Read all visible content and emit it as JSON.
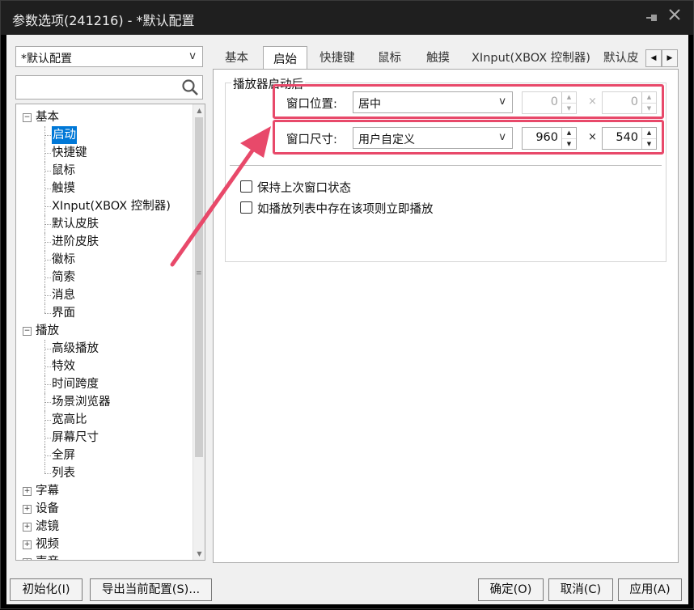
{
  "window": {
    "title": "参数选项(241216) - *默认配置",
    "pin_icon": "pin-icon",
    "close_icon": "close-icon"
  },
  "sidebar": {
    "profile": "*默认配置",
    "search_placeholder": "",
    "tree": [
      {
        "label": "基本",
        "type": "parent",
        "expander": "⊟"
      },
      {
        "label": "启动",
        "type": "child",
        "selected": true
      },
      {
        "label": "快捷键",
        "type": "child"
      },
      {
        "label": "鼠标",
        "type": "child"
      },
      {
        "label": "触摸",
        "type": "child"
      },
      {
        "label": "XInput(XBOX 控制器)",
        "type": "child"
      },
      {
        "label": "默认皮肤",
        "type": "child"
      },
      {
        "label": "进阶皮肤",
        "type": "child"
      },
      {
        "label": "徽标",
        "type": "child"
      },
      {
        "label": "简索",
        "type": "child"
      },
      {
        "label": "消息",
        "type": "child"
      },
      {
        "label": "界面",
        "type": "child",
        "last": true
      },
      {
        "label": "播放",
        "type": "parent",
        "expander": "⊟"
      },
      {
        "label": "高级播放",
        "type": "child"
      },
      {
        "label": "特效",
        "type": "child"
      },
      {
        "label": "时间跨度",
        "type": "child"
      },
      {
        "label": "场景浏览器",
        "type": "child"
      },
      {
        "label": "宽高比",
        "type": "child"
      },
      {
        "label": "屏幕尺寸",
        "type": "child"
      },
      {
        "label": "全屏",
        "type": "child"
      },
      {
        "label": "列表",
        "type": "child",
        "last": true
      },
      {
        "label": "字幕",
        "type": "parent",
        "expander": "⊞"
      },
      {
        "label": "设备",
        "type": "parent",
        "expander": "⊞"
      },
      {
        "label": "滤镜",
        "type": "parent",
        "expander": "⊞"
      },
      {
        "label": "视频",
        "type": "parent",
        "expander": "⊞"
      },
      {
        "label": "声音",
        "type": "parent",
        "expander": "⊞"
      }
    ]
  },
  "tabs": [
    "基本",
    "启始",
    "快捷键",
    "鼠标",
    "触摸",
    "XInput(XBOX 控制器)",
    "默认皮"
  ],
  "active_tab_index": 1,
  "group": {
    "legend": "播放器启动后",
    "position_label": "窗口位置:",
    "position_value": "居中",
    "position_x": "0",
    "position_y": "0",
    "size_label": "窗口尺寸:",
    "size_value": "用户自定义",
    "size_w": "960",
    "size_h": "540",
    "times": "×"
  },
  "checkboxes": [
    {
      "label": "保持上次窗口状态",
      "checked": false
    },
    {
      "label": "如播放列表中存在该项则立即播放",
      "checked": false
    }
  ],
  "buttons": {
    "reset": "初始化(I)",
    "export": "导出当前配置(S)...",
    "ok": "确定(O)",
    "cancel": "取消(C)",
    "apply": "应用(A)"
  },
  "colors": {
    "highlight": "#e8496a",
    "selection": "#0078d7",
    "titlebar": "#1f1f1f"
  }
}
